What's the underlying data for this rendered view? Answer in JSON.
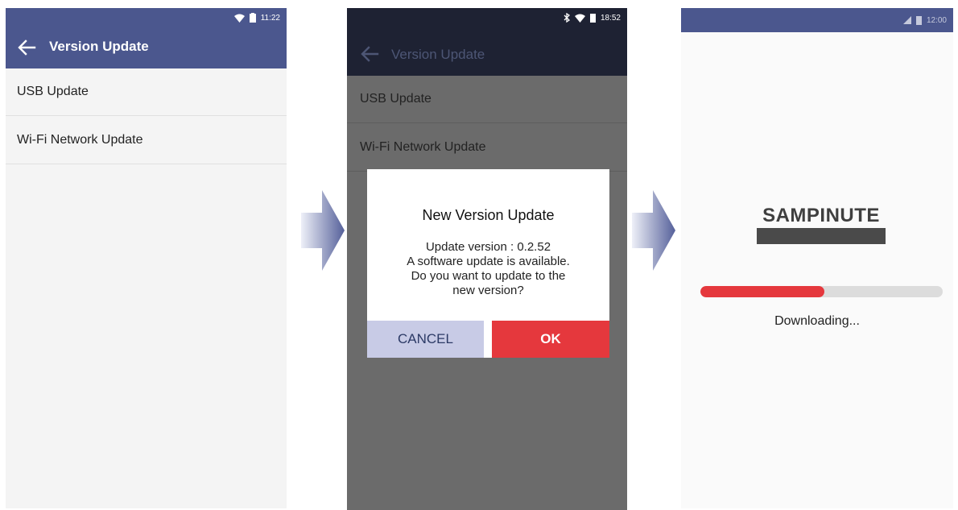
{
  "screen1": {
    "status_time": "11:22",
    "title": "Version Update",
    "items": [
      {
        "label": "USB Update"
      },
      {
        "label": "Wi-Fi Network Update"
      }
    ]
  },
  "screen2": {
    "status_time": "18:52",
    "title": "Version Update",
    "items": [
      {
        "label": "USB Update"
      },
      {
        "label": "Wi-Fi Network Update"
      }
    ],
    "dialog": {
      "title": "New Version Update",
      "lines": [
        "Update version : 0.2.52",
        "A software update is available.",
        "Do you want to update to the",
        "new version?"
      ],
      "cancel_label": "CANCEL",
      "ok_label": "OK"
    }
  },
  "screen3": {
    "status_time": "12:00",
    "brand": "SAMPINUTE",
    "progress_fraction": 0.51,
    "status_label": "Downloading..."
  },
  "colors": {
    "appbar": "#4b578e",
    "appbar_dark": "#1e2233",
    "accent_red": "#e5383d",
    "cancel_bg": "#c8cbe6"
  }
}
